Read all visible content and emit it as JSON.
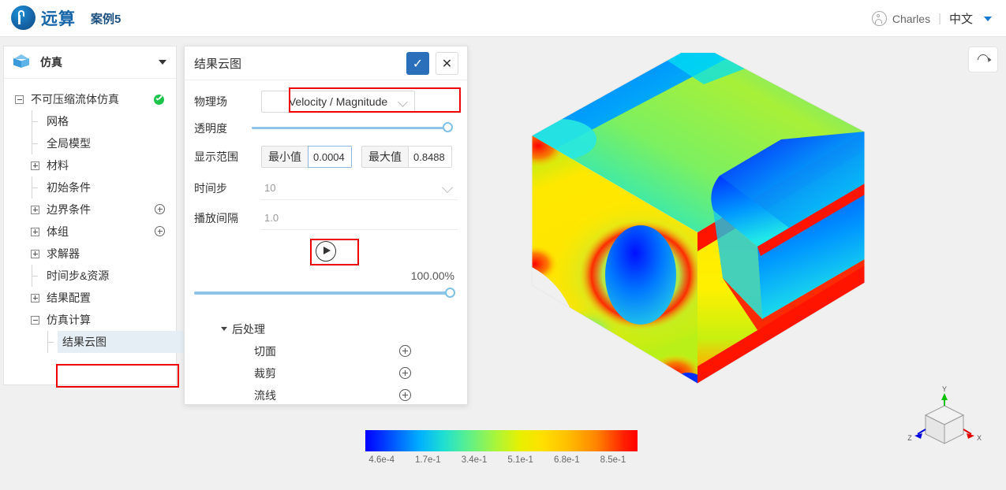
{
  "header": {
    "brand_name": "远算",
    "case_title": "案例5",
    "user_name": "Charles",
    "separator": "|",
    "language": "中文"
  },
  "sidebar": {
    "head_title": "仿真",
    "tree": [
      {
        "label": "不可压缩流体仿真",
        "level": 0,
        "marker": "minus",
        "status": "ok"
      },
      {
        "label": "网格",
        "level": 1,
        "marker": "leaf"
      },
      {
        "label": "全局模型",
        "level": 1,
        "marker": "leaf"
      },
      {
        "label": "材料",
        "level": 1,
        "marker": "plus"
      },
      {
        "label": "初始条件",
        "level": 1,
        "marker": "leaf"
      },
      {
        "label": "边界条件",
        "level": 1,
        "marker": "plus",
        "action": "add"
      },
      {
        "label": "体组",
        "level": 1,
        "marker": "plus",
        "action": "add"
      },
      {
        "label": "求解器",
        "level": 1,
        "marker": "plus"
      },
      {
        "label": "时间步&资源",
        "level": 1,
        "marker": "leaf"
      },
      {
        "label": "结果配置",
        "level": 1,
        "marker": "plus"
      },
      {
        "label": "仿真计算",
        "level": 1,
        "marker": "minus"
      },
      {
        "label": "结果云图",
        "level": 2,
        "marker": "leaf",
        "selected": true
      }
    ]
  },
  "panel": {
    "title": "结果云图",
    "confirm_label": "✓",
    "cancel_label": "✕",
    "fields": {
      "physics_field_label": "物理场",
      "physics_field_value": "Velocity / Magnitude",
      "opacity_label": "透明度",
      "opacity_value": "100",
      "range_label": "显示范围",
      "min_label": "最小值",
      "min_value": "0.0004",
      "max_label": "最大值",
      "max_value": "0.8488",
      "timestep_label": "时间步",
      "timestep_value": "10",
      "interval_label": "播放间隔",
      "interval_value": "1.0"
    },
    "progress_percent": "100.00%",
    "postprocess": {
      "title": "后处理",
      "items": [
        {
          "label": "切面"
        },
        {
          "label": "裁剪"
        },
        {
          "label": "流线"
        }
      ]
    }
  },
  "viewport": {
    "reset_tooltip": "",
    "axes": {
      "x": "X",
      "y": "Y",
      "z": "Z"
    }
  },
  "chart_data": {
    "type": "heatmap",
    "title": "Velocity / Magnitude",
    "colormap": "jet",
    "tick_labels": [
      "4.6e-4",
      "1.7e-1",
      "3.4e-1",
      "5.1e-1",
      "6.8e-1",
      "8.5e-1"
    ],
    "tick_values": [
      0.00046,
      0.17,
      0.34,
      0.51,
      0.68,
      0.85
    ],
    "vmin": 0.00046,
    "vmax": 0.8488,
    "legend_position": "bottom",
    "colors": {
      "low": "#0000ff",
      "mid_low": "#00b0ff",
      "mid": "#5ef08a",
      "mid_high": "#ffe000",
      "high": "#ff0000"
    }
  },
  "theme": {
    "brand_blue": "#1565a8",
    "accent_blue": "#2a6fba",
    "highlight_red": "#ee0000",
    "status_green": "#1bc44a",
    "slider_blue": "#8ec5e8",
    "selection_bg": "#e4eef4"
  }
}
